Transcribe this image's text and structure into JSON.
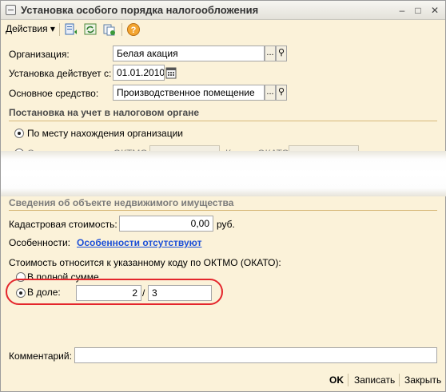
{
  "window": {
    "title": "Установка особого порядка налогообложения",
    "controls": [
      "–",
      "□",
      "✕"
    ]
  },
  "toolbar": {
    "actions_label": "Действия",
    "actions_arrow": "▾",
    "help_glyph": "?"
  },
  "form": {
    "organization_label": "Организация:",
    "organization_value": "Белая акация",
    "date_label": "Установка действует с:",
    "date_value": "01.01.2010",
    "asset_label": "Основное средство:",
    "asset_value": "Производственное помещение",
    "tax_section_title": "Постановка на учет в налоговом органе",
    "radio_by_location": "По месту нахождения организации",
    "radio_other_code": "С другим кодом по ОКТМО:",
    "okato_label": "Код по ОКАТО:",
    "property_section_title": "Сведения об объекте недвижимого имущества",
    "cadastral_label": "Кадастровая стоимость:",
    "cadastral_value": "0,00",
    "cadastral_unit": "руб.",
    "features_label": "Особенности:",
    "features_link": "Особенности отсутствуют",
    "cost_relates_label": "Стоимость относится к указанному коду по ОКТМО (ОКАТО):",
    "radio_full_sum": "В полной сумме",
    "radio_share": "В доле:",
    "share_numerator": "2",
    "share_slash": "/",
    "share_denominator": "3",
    "comment_label": "Комментарий:",
    "comment_value": "",
    "ellipsis": "...",
    "search_glyph": "⚲"
  },
  "footer": {
    "ok_label": "OK",
    "save_label": "Записать",
    "close_label": "Закрыть"
  },
  "colors": {
    "window_bg": "#fbf2d9",
    "link": "#1b4fd8",
    "highlight": "#e4262c",
    "section_line": "#d7b97a"
  }
}
